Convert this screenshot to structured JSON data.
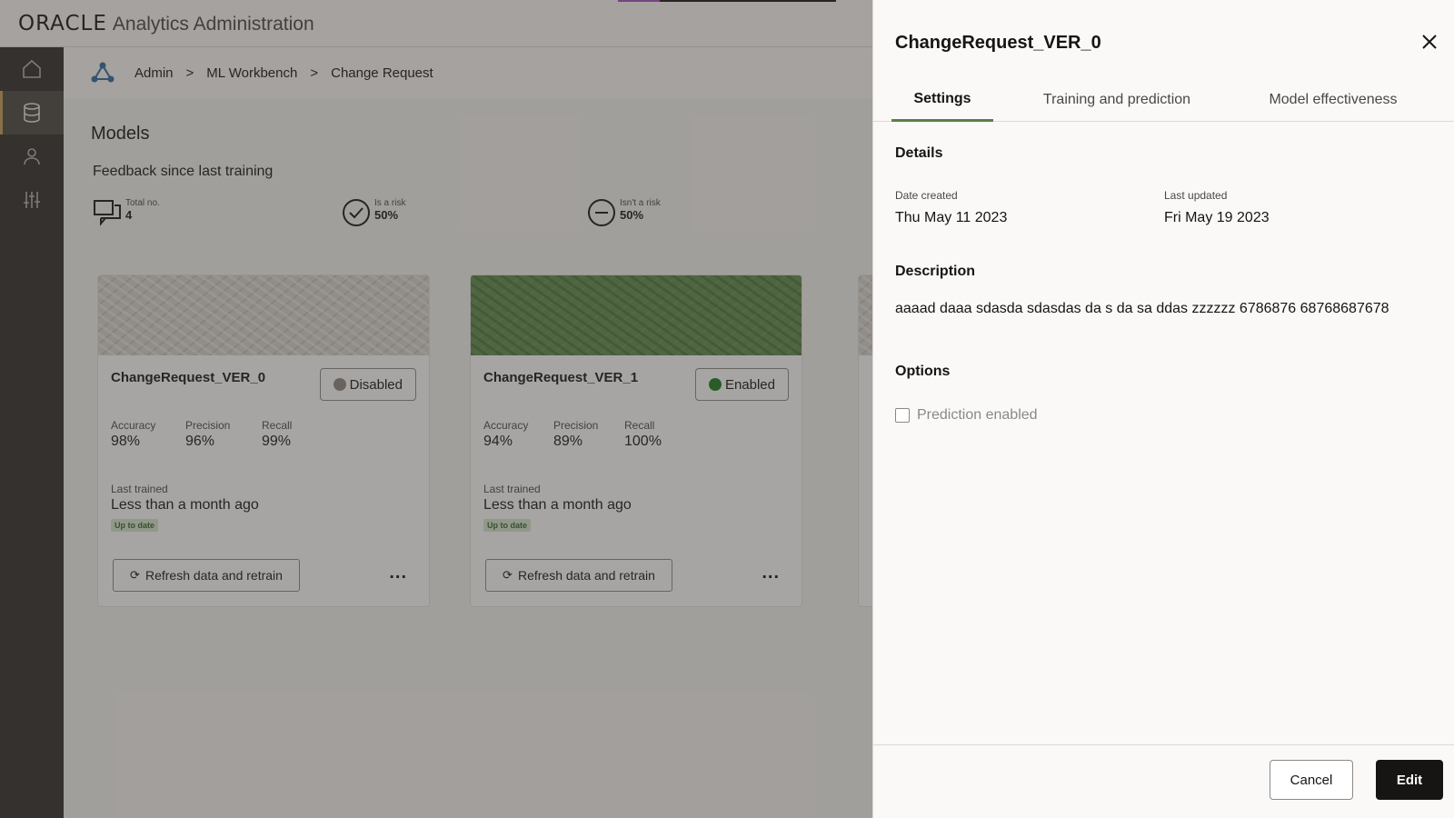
{
  "header": {
    "logo_text": "ORACLE",
    "app_name": "Analytics Administration"
  },
  "breadcrumb": [
    "Admin",
    ">",
    "ML Workbench",
    ">",
    "Change Request"
  ],
  "page": {
    "title": "Models",
    "feedback_title": "Feedback since last training",
    "stats": [
      {
        "label": "Total no.",
        "value": "4",
        "icon": "feedback-chat-icon"
      },
      {
        "label": "Is a risk",
        "value": "50%",
        "icon": "check-circle-icon"
      },
      {
        "label": "Isn't a risk",
        "value": "50%",
        "icon": "minus-circle-icon"
      }
    ]
  },
  "cards": [
    {
      "name": "ChangeRequest_VER_0",
      "status": "Disabled",
      "status_color": "#8c8884",
      "metrics": [
        {
          "label": "Accuracy",
          "value": "98%"
        },
        {
          "label": "Precision",
          "value": "96%"
        },
        {
          "label": "Recall",
          "value": "99%"
        }
      ],
      "last_trained_label": "Last trained",
      "last_trained_value": "Less than a month ago",
      "badge": "Up to date",
      "retrain_label": "Refresh data and retrain",
      "more": "..."
    },
    {
      "name": "ChangeRequest_VER_1",
      "status": "Enabled",
      "status_color": "#1e7a1e",
      "metrics": [
        {
          "label": "Accuracy",
          "value": "94%"
        },
        {
          "label": "Precision",
          "value": "89%"
        },
        {
          "label": "Recall",
          "value": "100%"
        }
      ],
      "last_trained_label": "Last trained",
      "last_trained_value": "Less than a month ago",
      "badge": "Up to date",
      "retrain_label": "Refresh data and retrain",
      "more": "..."
    }
  ],
  "drawer": {
    "title": "ChangeRequest_VER_0",
    "tabs": [
      "Settings",
      "Training and prediction",
      "Model effectiveness"
    ],
    "details_heading": "Details",
    "date_created_label": "Date created",
    "date_created_value": "Thu May 11 2023",
    "last_updated_label": "Last updated",
    "last_updated_value": "Fri May 19 2023",
    "description_heading": "Description",
    "description": "aaaad daaa sdasda sdasdas da s da sa ddas zzzzzz 6786876 68768687678",
    "options_heading": "Options",
    "prediction_enabled_label": "Prediction enabled",
    "cancel_label": "Cancel",
    "edit_label": "Edit"
  },
  "colors": {
    "nav_bg": "#312d2a",
    "tab_accent": "#5c7e4a",
    "enabled_banner": "#5f8a4e",
    "primary_button": "#161513"
  }
}
